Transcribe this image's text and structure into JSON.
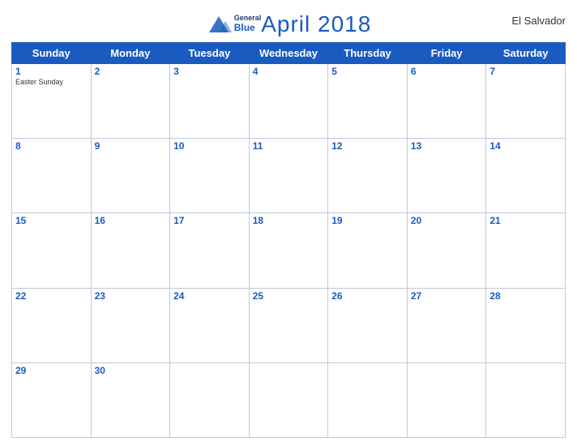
{
  "header": {
    "title": "April 2018",
    "country": "El Salvador",
    "logo_general": "General",
    "logo_blue": "Blue"
  },
  "days_of_week": [
    "Sunday",
    "Monday",
    "Tuesday",
    "Wednesday",
    "Thursday",
    "Friday",
    "Saturday"
  ],
  "weeks": [
    [
      {
        "day": "1",
        "holiday": "Easter Sunday"
      },
      {
        "day": "2",
        "holiday": ""
      },
      {
        "day": "3",
        "holiday": ""
      },
      {
        "day": "4",
        "holiday": ""
      },
      {
        "day": "5",
        "holiday": ""
      },
      {
        "day": "6",
        "holiday": ""
      },
      {
        "day": "7",
        "holiday": ""
      }
    ],
    [
      {
        "day": "8",
        "holiday": ""
      },
      {
        "day": "9",
        "holiday": ""
      },
      {
        "day": "10",
        "holiday": ""
      },
      {
        "day": "11",
        "holiday": ""
      },
      {
        "day": "12",
        "holiday": ""
      },
      {
        "day": "13",
        "holiday": ""
      },
      {
        "day": "14",
        "holiday": ""
      }
    ],
    [
      {
        "day": "15",
        "holiday": ""
      },
      {
        "day": "16",
        "holiday": ""
      },
      {
        "day": "17",
        "holiday": ""
      },
      {
        "day": "18",
        "holiday": ""
      },
      {
        "day": "19",
        "holiday": ""
      },
      {
        "day": "20",
        "holiday": ""
      },
      {
        "day": "21",
        "holiday": ""
      }
    ],
    [
      {
        "day": "22",
        "holiday": ""
      },
      {
        "day": "23",
        "holiday": ""
      },
      {
        "day": "24",
        "holiday": ""
      },
      {
        "day": "25",
        "holiday": ""
      },
      {
        "day": "26",
        "holiday": ""
      },
      {
        "day": "27",
        "holiday": ""
      },
      {
        "day": "28",
        "holiday": ""
      }
    ],
    [
      {
        "day": "29",
        "holiday": ""
      },
      {
        "day": "30",
        "holiday": ""
      },
      {
        "day": "",
        "holiday": ""
      },
      {
        "day": "",
        "holiday": ""
      },
      {
        "day": "",
        "holiday": ""
      },
      {
        "day": "",
        "holiday": ""
      },
      {
        "day": "",
        "holiday": ""
      }
    ]
  ],
  "accent_color": "#1a5bbf"
}
